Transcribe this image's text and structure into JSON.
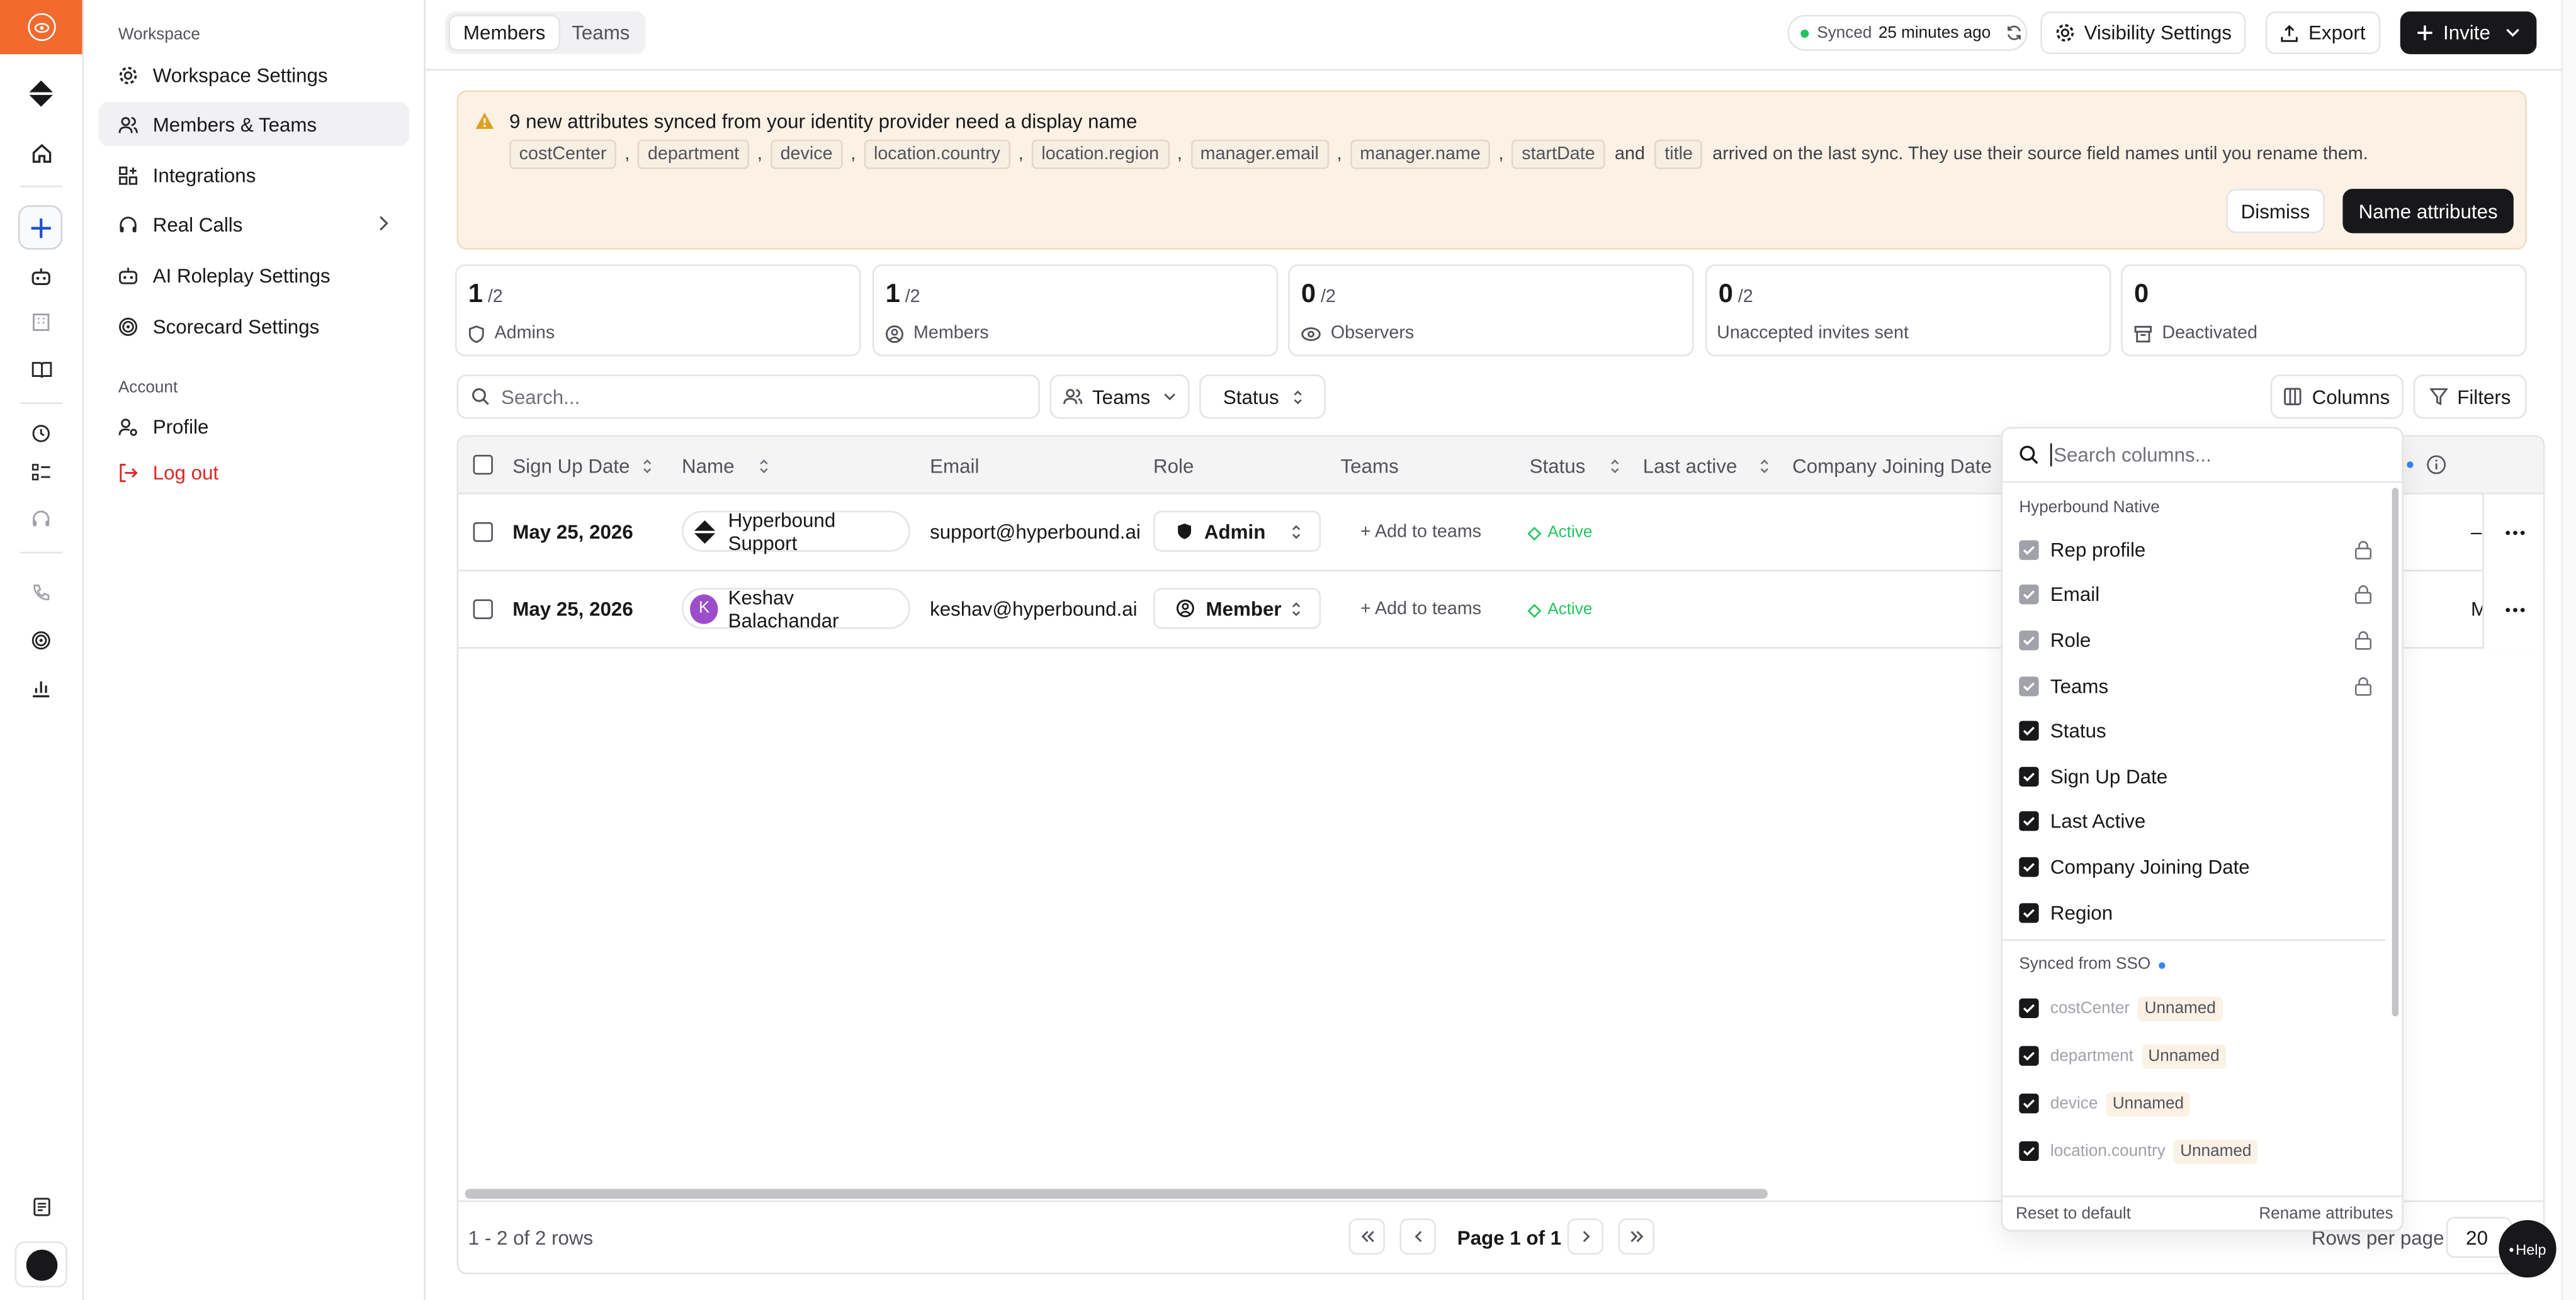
{
  "sidebar": {
    "workspace_heading": "Workspace",
    "items": [
      {
        "label": "Workspace Settings",
        "icon": "gear-icon"
      },
      {
        "label": "Members & Teams",
        "icon": "users-icon"
      },
      {
        "label": "Integrations",
        "icon": "grid-plus-icon"
      },
      {
        "label": "Real Calls",
        "icon": "headset-icon"
      },
      {
        "label": "AI Roleplay Settings",
        "icon": "bot-icon"
      },
      {
        "label": "Scorecard Settings",
        "icon": "target-icon"
      }
    ],
    "account_heading": "Account",
    "profile_label": "Profile",
    "logout_label": "Log out"
  },
  "topbar": {
    "tabs": [
      "Members",
      "Teams"
    ],
    "sync_label": "Synced",
    "sync_time": "25 minutes ago",
    "visibility_label": "Visibility Settings",
    "export_label": "Export",
    "invite_label": "Invite"
  },
  "banner": {
    "title": "9 new attributes synced from your identity provider need a display name",
    "attributes": [
      "costCenter",
      "department",
      "device",
      "location.country",
      "location.region",
      "manager.email",
      "manager.name",
      "startDate",
      "title"
    ],
    "and_word": "and",
    "suffix": "arrived on the last sync. They use their source field names until you rename them.",
    "dismiss_label": "Dismiss",
    "name_label": "Name attributes"
  },
  "stats": [
    {
      "count": "1",
      "total": "/2",
      "label": "Admins",
      "icon": "shield-icon"
    },
    {
      "count": "1",
      "total": "/2",
      "label": "Members",
      "icon": "user-circle-icon"
    },
    {
      "count": "0",
      "total": "/2",
      "label": "Observers",
      "icon": "eye-icon"
    },
    {
      "count": "0",
      "total": "/2",
      "label": "Unaccepted invites sent",
      "icon": ""
    },
    {
      "count": "0",
      "total": "",
      "label": "Deactivated",
      "icon": "archive-icon"
    }
  ],
  "filters": {
    "search_placeholder": "Search...",
    "teams_label": "Teams",
    "status_label": "Status",
    "columns_label": "Columns",
    "filters_label": "Filters"
  },
  "table": {
    "headers": [
      "Sign Up Date",
      "Name",
      "Email",
      "Role",
      "Teams",
      "Status",
      "Last active",
      "Company Joining Date"
    ],
    "rows": [
      {
        "signup": "May 25, 2026",
        "name": "Hyperbound Support",
        "email": "support@hyperbound.ai",
        "role": "Admin",
        "teams": "+ Add to teams",
        "status": "Active",
        "trailing": "–"
      },
      {
        "signup": "May 25, 2026",
        "name": "Keshav Balachandar",
        "initial": "K",
        "email": "keshav@hyperbound.ai",
        "role": "Member",
        "teams": "+ Add to teams",
        "status": "Active",
        "trailing": "M"
      }
    ],
    "row_count": "1 - 2 of 2 rows",
    "page_label": "Page 1 of 1",
    "rows_per_page_label": "Rows per page",
    "rows_per_page": "20"
  },
  "columns_popover": {
    "search_placeholder": "Search columns...",
    "native_heading": "Hyperbound Native",
    "native": [
      {
        "label": "Rep profile",
        "locked": true
      },
      {
        "label": "Email",
        "locked": true
      },
      {
        "label": "Role",
        "locked": true
      },
      {
        "label": "Teams",
        "locked": true
      },
      {
        "label": "Status",
        "locked": false
      },
      {
        "label": "Sign Up Date",
        "locked": false
      },
      {
        "label": "Last Active",
        "locked": false
      },
      {
        "label": "Company Joining Date",
        "locked": false
      },
      {
        "label": "Region",
        "locked": false
      }
    ],
    "sso_heading": "Synced from SSO",
    "sso": [
      "costCenter",
      "department",
      "device",
      "location.country"
    ],
    "unnamed_label": "Unnamed",
    "reset_label": "Reset to default",
    "rename_label": "Rename attributes"
  },
  "help_label": "Help",
  "colors": {
    "accent": "#f26a2e",
    "dark": "#18181b",
    "active_green": "#22c55e",
    "banner_bg": "#fbf1e4",
    "danger": "#dc2626"
  }
}
